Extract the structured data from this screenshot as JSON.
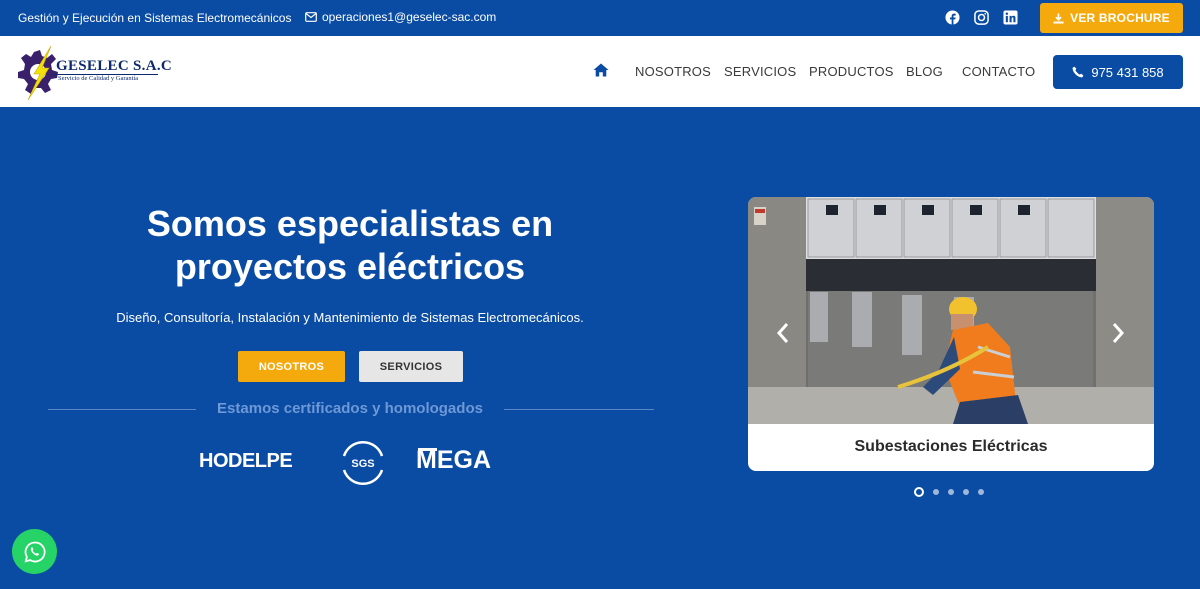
{
  "topbar": {
    "tagline": "Gestión y Ejecución en Sistemas Electromecánicos",
    "email": "operaciones1@geselec-sac.com",
    "social_icons": [
      "facebook-icon",
      "instagram-icon",
      "linkedin-icon"
    ],
    "brochure_label": "VER BROCHURE"
  },
  "header": {
    "logo_name": "GESELEC S.A.C",
    "logo_tagline": "Servicio de Calidad  y Garantía",
    "nav": [
      "NOSOTROS",
      "SERVICIOS",
      "PRODUCTOS",
      "BLOG",
      "CONTACTO"
    ],
    "phone": "975 431 858"
  },
  "hero": {
    "title_line1": "Somos especialistas en",
    "title_line2": "proyectos eléctricos",
    "subtitle": "Diseño, Consultoría, Instalación y Mantenimiento de Sistemas Electromecánicos.",
    "btn_primary": "NOSOTROS",
    "btn_secondary": "SERVICIOS",
    "cert_heading": "Estamos certificados y homologados",
    "cert_logos": {
      "hodelpe": "HODELPE",
      "sgs": "SGS",
      "mega": "MEGA"
    }
  },
  "slider": {
    "caption": "Subestaciones Eléctricas",
    "slide_count": 5,
    "active_slide": 1
  },
  "colors": {
    "brand_blue": "#0a4ca3",
    "accent_orange": "#f4a90d",
    "whatsapp_green": "#25d366"
  }
}
